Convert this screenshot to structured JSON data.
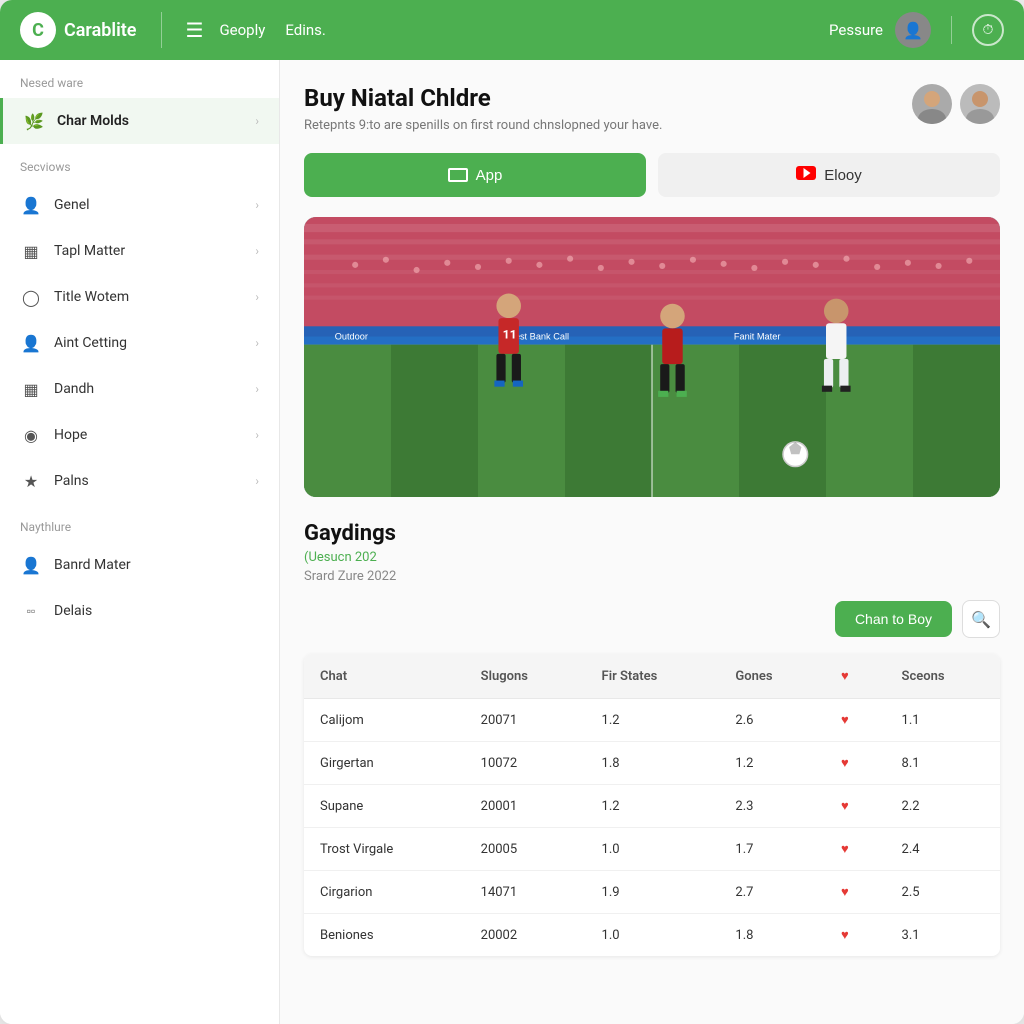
{
  "app": {
    "logo_letter": "C",
    "logo_name": "Carablite"
  },
  "nav": {
    "hamburger": "☰",
    "links": [
      "Geoply",
      "Edins."
    ],
    "username": "Pessure",
    "clock_symbol": "⏱"
  },
  "sidebar": {
    "section1_label": "Nesed ware",
    "active_item": {
      "label": "Char Molds",
      "icon": "🌿"
    },
    "section2_label": "Secviows",
    "items": [
      {
        "label": "Genel",
        "icon": "👤"
      },
      {
        "label": "Tapl Matter",
        "icon": "▦"
      },
      {
        "label": "Title Wotem",
        "icon": "◯"
      },
      {
        "label": "Aint Cetting",
        "icon": "👤"
      },
      {
        "label": "Dandh",
        "icon": "▦"
      },
      {
        "label": "Hope",
        "icon": "◉"
      },
      {
        "label": "Palns",
        "icon": "★"
      }
    ],
    "section3_label": "Naythlure",
    "bottom_items": [
      {
        "label": "Banrd Mater",
        "icon": "👤"
      },
      {
        "label": "Delais",
        "icon": "▫"
      }
    ]
  },
  "main": {
    "page_title": "Buy Niatal Chldre",
    "page_subtitle": "Retepnts 9:to are spenills on first round chnslopned your have.",
    "btn_primary_label": "App",
    "btn_secondary_label": "Elooy",
    "section_title": "Gaydings",
    "section_subtitle": "(Uesucn 202",
    "section_meta": "Srard Zure 2022",
    "btn_action_label": "Chan to Boy",
    "table": {
      "columns": [
        "Chat",
        "Slugons",
        "Fir States",
        "Gones",
        "♥",
        "Sceons"
      ],
      "rows": [
        [
          "Calijom",
          "20071",
          "1.2",
          "2.6",
          "",
          "1.1"
        ],
        [
          "Girgertan",
          "10072",
          "1.8",
          "1.2",
          "",
          "8.1"
        ],
        [
          "Supane",
          "20001",
          "1.2",
          "2.3",
          "",
          "2.2"
        ],
        [
          "Trost Virgale",
          "20005",
          "1.0",
          "1.7",
          "",
          "2.4"
        ],
        [
          "Cirgarion",
          "14071",
          "1.9",
          "2.7",
          "",
          "2.5"
        ],
        [
          "Beniones",
          "20002",
          "1.0",
          "1.8",
          "",
          "3.1"
        ]
      ]
    }
  }
}
